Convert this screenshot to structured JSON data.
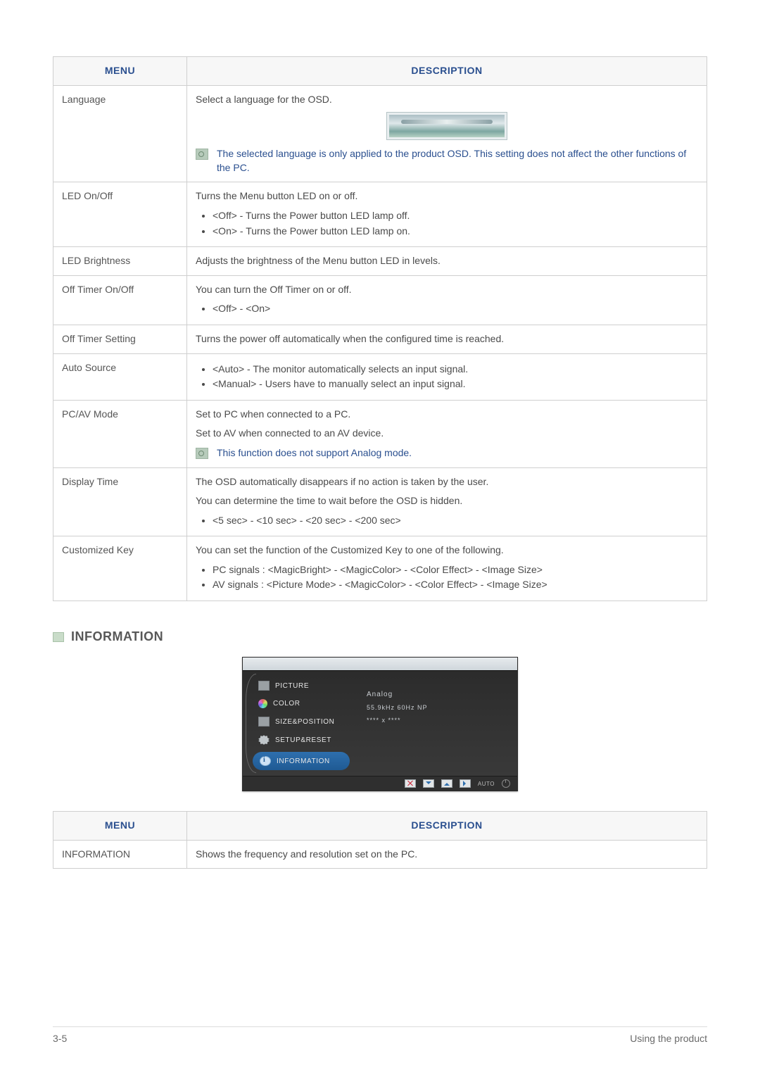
{
  "tables": {
    "main": {
      "headers": {
        "menu": "MENU",
        "description": "DESCRIPTION"
      },
      "rows": {
        "language": {
          "menu": "Language",
          "intro": "Select a language for the OSD.",
          "note": "The selected language is only applied to the product OSD. This setting does not affect the other functions of the PC."
        },
        "led_onoff": {
          "menu": "LED On/Off",
          "intro": "Turns the Menu button LED on or off.",
          "bullets": [
            "<Off> - Turns the Power button LED lamp off.",
            "<On> - Turns the Power button LED lamp on."
          ]
        },
        "led_brightness": {
          "menu": "LED Brightness",
          "intro": "Adjusts the brightness of the Menu button LED in levels."
        },
        "off_timer_onoff": {
          "menu": "Off Timer On/Off",
          "intro": "You can turn the Off Timer on or off.",
          "bullets": [
            "<Off> - <On>"
          ]
        },
        "off_timer_setting": {
          "menu": "Off Timer Setting",
          "intro": "Turns the power off automatically when the configured time is reached."
        },
        "auto_source": {
          "menu": "Auto Source",
          "bullets": [
            "<Auto> - The monitor automatically selects an input signal.",
            "<Manual> - Users have to manually select an input signal."
          ]
        },
        "pc_av_mode": {
          "menu": "PC/AV Mode",
          "intro1": "Set to PC when connected to a PC.",
          "intro2": "Set to AV when connected to an AV device.",
          "note": "This function does not support Analog mode."
        },
        "display_time": {
          "menu": "Display Time",
          "intro1": "The OSD automatically disappears if no action is taken by the user.",
          "intro2": "You can determine the time to wait before the OSD is hidden.",
          "bullets": [
            "<5 sec> - <10 sec> - <20 sec> - <200 sec>"
          ]
        },
        "customized_key": {
          "menu": "Customized Key",
          "intro": "You can set the function of the Customized Key to one of the following.",
          "bullets": [
            "PC signals : <MagicBright> - <MagicColor> - <Color Effect> - <Image Size>",
            "AV signals : <Picture Mode> - <MagicColor> - <Color Effect> - <Image Size>"
          ]
        }
      }
    },
    "info": {
      "headers": {
        "menu": "MENU",
        "description": "DESCRIPTION"
      },
      "row": {
        "menu": "INFORMATION",
        "description": "Shows the frequency and resolution set on the PC."
      }
    }
  },
  "section": {
    "information_heading": "INFORMATION"
  },
  "osd": {
    "items": {
      "picture": "PICTURE",
      "color": "COLOR",
      "size_position": "SIZE&POSITION",
      "setup_reset": "SETUP&RESET",
      "information": "INFORMATION"
    },
    "right": {
      "line1": "Analog",
      "line2": "55.9kHz 60Hz NP",
      "line3": "**** x ****"
    },
    "bottom": {
      "auto": "AUTO"
    }
  },
  "footer": {
    "left": "3-5",
    "right": "Using the product"
  }
}
